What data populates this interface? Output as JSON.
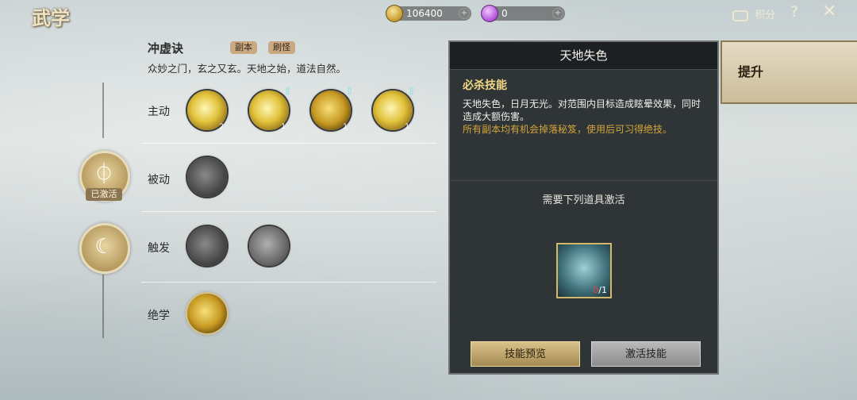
{
  "title": "武学",
  "resources": {
    "coins": "106400",
    "gems": "0",
    "score_label": "积分"
  },
  "icons": {
    "coin": "coin-icon",
    "gem": "gem-icon",
    "score": "score-icon",
    "help": "?",
    "close": "✕"
  },
  "skill": {
    "name": "冲虚诀",
    "tags": [
      "副本",
      "刷怪"
    ],
    "description": "众妙之门，玄之又玄。天地之始，道法自然。"
  },
  "left": {
    "activated_label": "已激活"
  },
  "rows": {
    "active": {
      "label": "主动",
      "counts": [
        "2",
        "1",
        "1",
        "1"
      ]
    },
    "passive": {
      "label": "被动"
    },
    "trigger": {
      "label": "触发"
    },
    "ultimate": {
      "label": "绝学"
    }
  },
  "panel": {
    "title": "天地失色",
    "type": "必杀技能",
    "desc": "天地失色，日月无光。对范围内目标造成眩晕效果，同时造成大额伤害。",
    "note": "所有副本均有机会掉落秘笈，使用后可习得绝技。",
    "need": "需要下列道具激活",
    "item_have": "0",
    "item_need": "/1",
    "btn_preview": "技能预览",
    "btn_activate": "激活技能"
  },
  "tab": {
    "upgrade": "提升"
  }
}
